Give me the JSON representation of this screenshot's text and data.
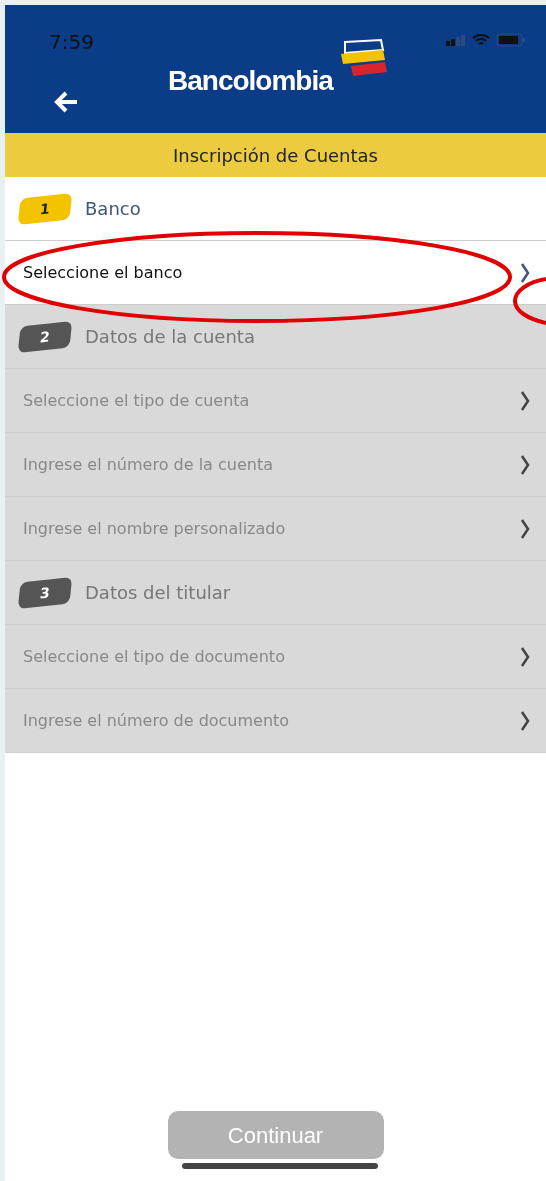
{
  "status_bar": {
    "time": "7:59"
  },
  "header": {
    "brand": "Bancolombia"
  },
  "title": "Inscripción de Cuentas",
  "sections": [
    {
      "number": "1",
      "title": "Banco",
      "active": true,
      "rows": [
        {
          "label": "Seleccione el banco"
        }
      ]
    },
    {
      "number": "2",
      "title": "Datos de la cuenta",
      "active": false,
      "rows": [
        {
          "label": "Seleccione el tipo de cuenta"
        },
        {
          "label": "Ingrese el número de la cuenta"
        },
        {
          "label": "Ingrese el nombre personalizado"
        }
      ]
    },
    {
      "number": "3",
      "title": "Datos del titular",
      "active": false,
      "rows": [
        {
          "label": "Seleccione el tipo de documento"
        },
        {
          "label": "Ingrese el número de documento"
        }
      ]
    }
  ],
  "button": {
    "label": "Continuar",
    "disabled": true
  }
}
